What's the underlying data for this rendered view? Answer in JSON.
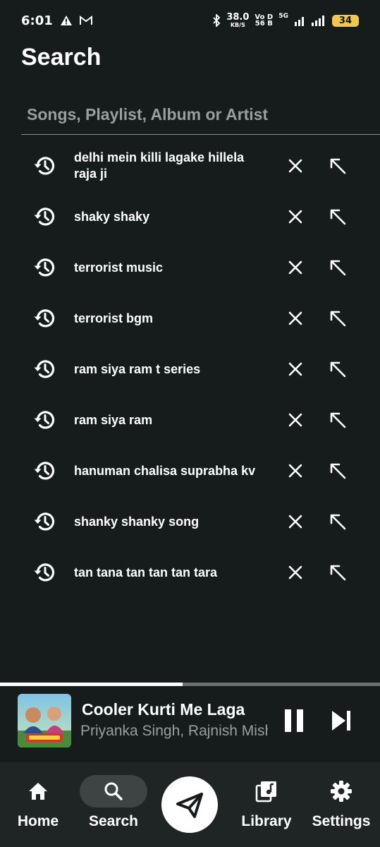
{
  "status": {
    "time": "6:01",
    "speed_value": "38.0",
    "speed_unit": "KB/S",
    "volte_top": "Vo D",
    "volte_bottom": "56 B",
    "network": "5G",
    "battery": "34"
  },
  "page": {
    "title": "Search"
  },
  "search": {
    "placeholder": "Songs, Playlist, Album or Artist",
    "value": ""
  },
  "history": [
    {
      "text": "delhi mein killi lagake hillela raja ji"
    },
    {
      "text": "shaky shaky"
    },
    {
      "text": "terrorist music"
    },
    {
      "text": "terrorist bgm"
    },
    {
      "text": "ram siya ram t series"
    },
    {
      "text": "ram siya ram"
    },
    {
      "text": "hanuman chalisa suprabha kv"
    },
    {
      "text": "shanky shanky song"
    },
    {
      "text": "tan tana tan tan tan tara"
    }
  ],
  "player": {
    "title": "Cooler Kurti Me Laga",
    "artist": "Priyanka Singh, Rajnish Mishra",
    "progress": 0.48
  },
  "nav": {
    "home": "Home",
    "search": "Search",
    "library": "Library",
    "settings": "Settings"
  },
  "colors": {
    "background": "#161c1b",
    "navbar": "#1f2524",
    "active_pill": "#3d4443",
    "battery": "#f2c84b"
  }
}
